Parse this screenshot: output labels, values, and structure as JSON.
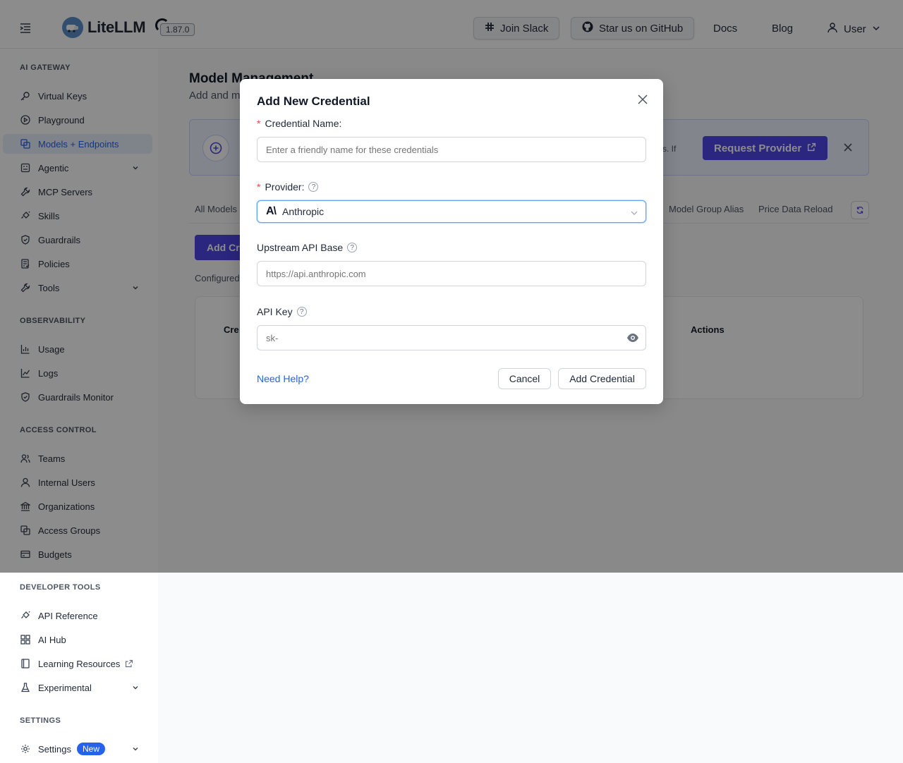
{
  "app": {
    "brand": "LiteLLM",
    "version": "1.87.0"
  },
  "topbar": {
    "join_slack": "Join Slack",
    "star_github": "Star us on GitHub",
    "docs": "Docs",
    "blog": "Blog",
    "user": "User"
  },
  "sidebar": {
    "sections": {
      "ai_gateway": "AI GATEWAY",
      "observability": "OBSERVABILITY",
      "access_control": "ACCESS CONTROL",
      "developer_tools": "DEVELOPER TOOLS",
      "settings": "SETTINGS"
    },
    "items": {
      "virtual_keys": "Virtual Keys",
      "playground": "Playground",
      "models_endpoints": "Models + Endpoints",
      "agentic": "Agentic",
      "mcp_servers": "MCP Servers",
      "skills": "Skills",
      "guardrails": "Guardrails",
      "policies": "Policies",
      "tools": "Tools",
      "usage": "Usage",
      "logs": "Logs",
      "guardrails_monitor": "Guardrails Monitor",
      "teams": "Teams",
      "internal_users": "Internal Users",
      "organizations": "Organizations",
      "access_groups": "Access Groups",
      "budgets": "Budgets",
      "api_reference": "API Reference",
      "ai_hub": "AI Hub",
      "learning_resources": "Learning Resources",
      "experimental": "Experimental",
      "settings": "Settings"
    },
    "settings_badge": "New"
  },
  "main": {
    "title": "Model Management",
    "subtitle": "Add and m",
    "banner_text": "s. If",
    "request_provider": "Request Provider",
    "tabs": {
      "all_models": "All Models",
      "model_group_alias": "Model Group Alias",
      "price_data_reload": "Price Data Reload"
    },
    "add_credential_btn": "Add Cre",
    "configured": "Configured",
    "table_headers": {
      "credential": "Cre",
      "actions": "Actions"
    }
  },
  "modal": {
    "title": "Add New Credential",
    "credential_name_label": "Credential Name:",
    "credential_name_placeholder": "Enter a friendly name for these credentials",
    "provider_label": "Provider:",
    "provider_value": "Anthropic",
    "api_base_label": "Upstream API Base",
    "api_base_placeholder": "https://api.anthropic.com",
    "api_key_label": "API Key",
    "api_key_placeholder": "sk-",
    "need_help": "Need Help?",
    "cancel": "Cancel",
    "submit": "Add Credential"
  },
  "colors": {
    "accent": "#4f46e5",
    "link": "#2563eb",
    "required": "#ef4444"
  }
}
